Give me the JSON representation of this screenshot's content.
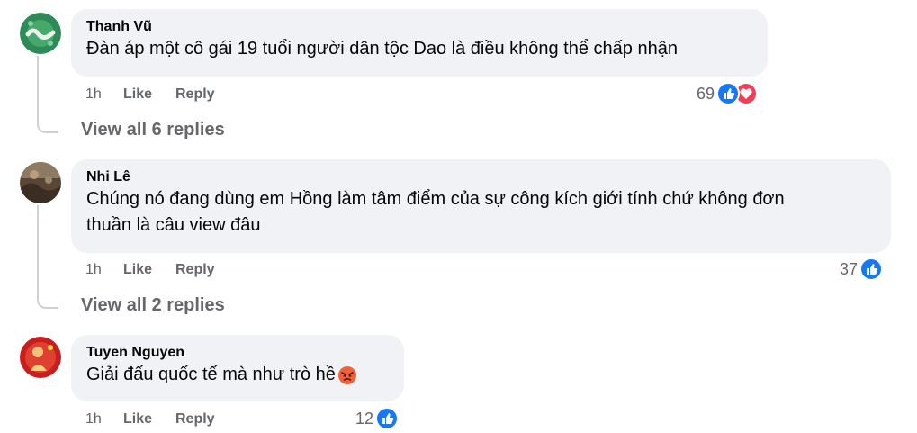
{
  "comments": [
    {
      "author": "Thanh Vũ",
      "text": "Đàn áp một cô gái 19 tuổi người dân tộc Dao là điều không thể chấp nhận",
      "time": "1h",
      "like": "Like",
      "reply": "Reply",
      "reaction_count": "69",
      "reactions": [
        "like-icon",
        "love-icon"
      ],
      "view_replies": "View all 6 replies"
    },
    {
      "author": "Nhi Lê",
      "text_line1": "Chúng nó đang dùng em Hồng làm tâm điểm của sự công kích giới tính chứ không đơn",
      "text_line2": "thuần là câu view đâu",
      "time": "1h",
      "like": "Like",
      "reply": "Reply",
      "reaction_count": "37",
      "reactions": [
        "like-icon"
      ],
      "view_replies": "View all 2 replies"
    },
    {
      "author": "Tuyen Nguyen",
      "text": "Giải đấu quốc tế mà như trò hề",
      "emoji": "angry-face-emoji",
      "time": "1h",
      "like": "Like",
      "reply": "Reply",
      "reaction_count": "12",
      "reactions": [
        "like-icon"
      ]
    }
  ],
  "colors": {
    "bubble": "#f0f2f5",
    "like_blue": "#1877f2",
    "love_red": "#f33e58",
    "meta_gray": "#65676b"
  }
}
